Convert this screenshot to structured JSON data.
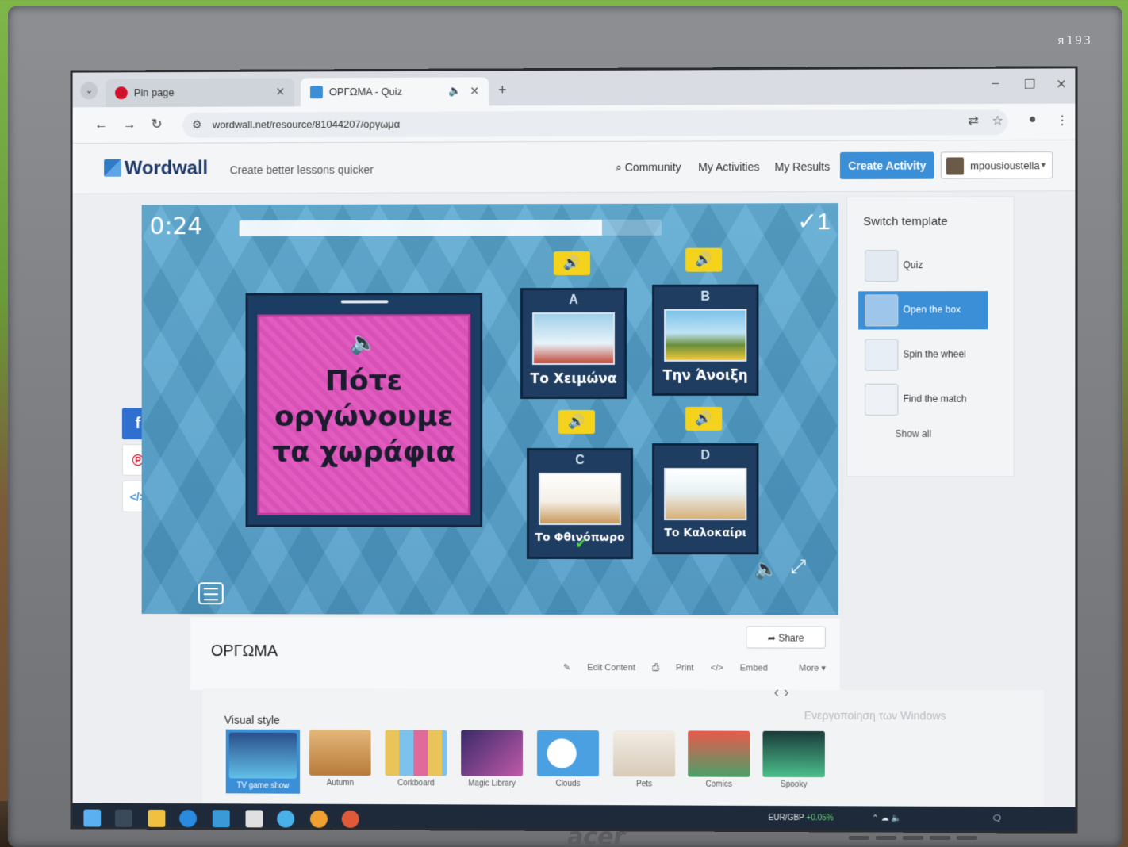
{
  "monitor": {
    "model_label": "ᴙ193",
    "brand": "acer"
  },
  "browser": {
    "tabs": [
      {
        "label": "Pin page",
        "active": false,
        "icon": "pinterest-icon"
      },
      {
        "label": "ΟΡΓΩΜΑ - Quiz",
        "active": true,
        "icon": "wordwall-icon"
      }
    ],
    "url": "wordwall.net/resource/81044207/οργωμα"
  },
  "header": {
    "logo": "Wordwall",
    "tagline": "Create better lessons quicker",
    "nav": [
      "Community",
      "My Activities",
      "My Results"
    ],
    "create_button": "Create Activity",
    "user": "mpousioustella"
  },
  "game": {
    "timer": "0:24",
    "progress": 0.86,
    "score": "✓1",
    "question": "Πότε οργώνουμε τα χωράφια",
    "answers": [
      {
        "letter": "A",
        "label": "Το Χειμώνα",
        "correct": false
      },
      {
        "letter": "B",
        "label": "Την Άνοιξη",
        "correct": false
      },
      {
        "letter": "C",
        "label": "Το Φθινόπωρο",
        "correct": true
      },
      {
        "letter": "D",
        "label": "Το Καλοκαίρι",
        "correct": false
      }
    ]
  },
  "templates": {
    "title": "Switch template",
    "items": [
      "Quiz",
      "Open the box",
      "Spin the wheel",
      "Find the match"
    ],
    "selected": "Open the box",
    "show_all": "Show all"
  },
  "activity": {
    "title": "ΟΡΓΩΜΑ",
    "share": "Share",
    "links": [
      "Edit Content",
      "Print",
      "Embed",
      "More"
    ]
  },
  "visual_style": {
    "title": "Visual style",
    "items": [
      "TV game show",
      "Autumn",
      "Corkboard",
      "Magic Library",
      "Clouds",
      "Pets",
      "Comics",
      "Spooky"
    ],
    "selected": "TV game show"
  },
  "watermark": "Ενεργοποίηση των Windows",
  "taskbar": {
    "ticker": "EUR/GBP",
    "ticker_change": "+0.05%"
  },
  "colors": {
    "wordwall_blue": "#3a8fd6",
    "question_pink": "#e25cc0",
    "answer_navy": "#1f3d61",
    "speaker_yellow": "#f5d21c",
    "game_bg": "#5aa8d1"
  }
}
